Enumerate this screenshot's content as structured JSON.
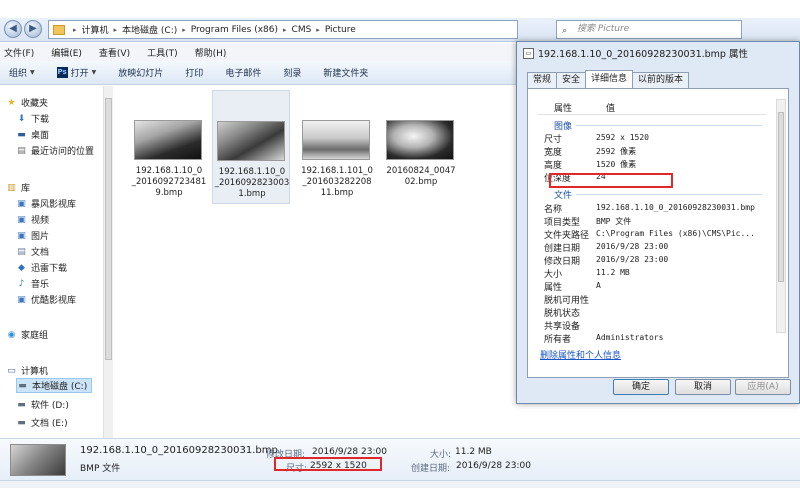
{
  "explorer": {
    "breadcrumbs": [
      "计算机",
      "本地磁盘 (C:)",
      "Program Files (x86)",
      "CMS",
      "Picture"
    ],
    "search_placeholder": "搜索 Picture",
    "menu": [
      "文件(F)",
      "编辑(E)",
      "查看(V)",
      "工具(T)",
      "帮助(H)"
    ],
    "toolbar": [
      "组织",
      "打开",
      "放映幻灯片",
      "打印",
      "电子邮件",
      "刻录",
      "新建文件夹"
    ],
    "nav": {
      "favorites": "收藏夹",
      "favorite_items": [
        "下载",
        "桌面",
        "最近访问的位置"
      ],
      "libraries": "库",
      "library_items": [
        "暴风影视库",
        "视频",
        "图片",
        "文档",
        "迅雷下载",
        "音乐",
        "优酷影视库"
      ],
      "homegroup": "家庭组",
      "computer": "计算机",
      "drives": [
        "本地磁盘 (C:)",
        "软件 (D:)",
        "文档 (E:)"
      ]
    },
    "files": [
      {
        "name": "192.168.1.10_0_20160927234819.bmp",
        "label_lines": [
          "192.168.1.10_0",
          "_2016092723481",
          "9.bmp"
        ]
      },
      {
        "name": "192.168.1.10_0_20160928230031.bmp",
        "label_lines": [
          "192.168.1.10_0",
          "_2016092823003",
          "1.bmp"
        ]
      },
      {
        "name": "192.168.1.101_0_20160328220811.bmp",
        "label_lines": [
          "192.168.1.101_0",
          "_201603282208",
          "11.bmp"
        ]
      },
      {
        "name": "20160824_004702.bmp",
        "label_lines": [
          "20160824_0047",
          "02.bmp"
        ]
      }
    ],
    "details": {
      "filename": "192.168.1.10_0_20160928230031.bmp",
      "type": "BMP 文件",
      "modified_label": "修改日期:",
      "modified_value": "2016/9/28 23:00",
      "dimensions_label": "尺寸:",
      "dimensions_value": "2592 x 1520",
      "size_label": "大小:",
      "size_value": "11.2 MB",
      "created_label": "创建日期:",
      "created_value": "2016/9/28 23:00"
    }
  },
  "dialog": {
    "title": "192.168.1.10_0_20160928230031.bmp 属性",
    "tabs": [
      "常规",
      "安全",
      "详细信息",
      "以前的版本"
    ],
    "active_tab": "详细信息",
    "columns": {
      "property": "属性",
      "value": "值"
    },
    "sections": {
      "image": "图像",
      "file": "文件"
    },
    "image_props": [
      {
        "name": "尺寸",
        "value": "2592 x 1520"
      },
      {
        "name": "宽度",
        "value": "2592 像素"
      },
      {
        "name": "高度",
        "value": "1520 像素"
      },
      {
        "name": "位深度",
        "value": "24"
      }
    ],
    "file_props": [
      {
        "name": "名称",
        "value": "192.168.1.10_0_20160928230031.bmp"
      },
      {
        "name": "项目类型",
        "value": "BMP 文件"
      },
      {
        "name": "文件夹路径",
        "value": "C:\\Program Files (x86)\\CMS\\Pic..."
      },
      {
        "name": "创建日期",
        "value": "2016/9/28 23:00"
      },
      {
        "name": "修改日期",
        "value": "2016/9/28 23:00"
      },
      {
        "name": "大小",
        "value": "11.2 MB"
      },
      {
        "name": "属性",
        "value": "A"
      },
      {
        "name": "脱机可用性",
        "value": ""
      },
      {
        "name": "脱机状态",
        "value": ""
      },
      {
        "name": "共享设备",
        "value": ""
      },
      {
        "name": "所有者",
        "value": "Administrators"
      }
    ],
    "remove_link": "删除属性和个人信息",
    "buttons": {
      "ok": "确定",
      "cancel": "取消",
      "apply": "应用(A)"
    }
  },
  "colors": {
    "highlight": "#e0272a",
    "link": "#1a56c4",
    "section": "#1b4fa8"
  },
  "icons": [
    "back-icon",
    "forward-icon",
    "folder-icon",
    "search-icon",
    "star-icon",
    "drive-icon",
    "computer-icon",
    "homegroup-icon"
  ]
}
